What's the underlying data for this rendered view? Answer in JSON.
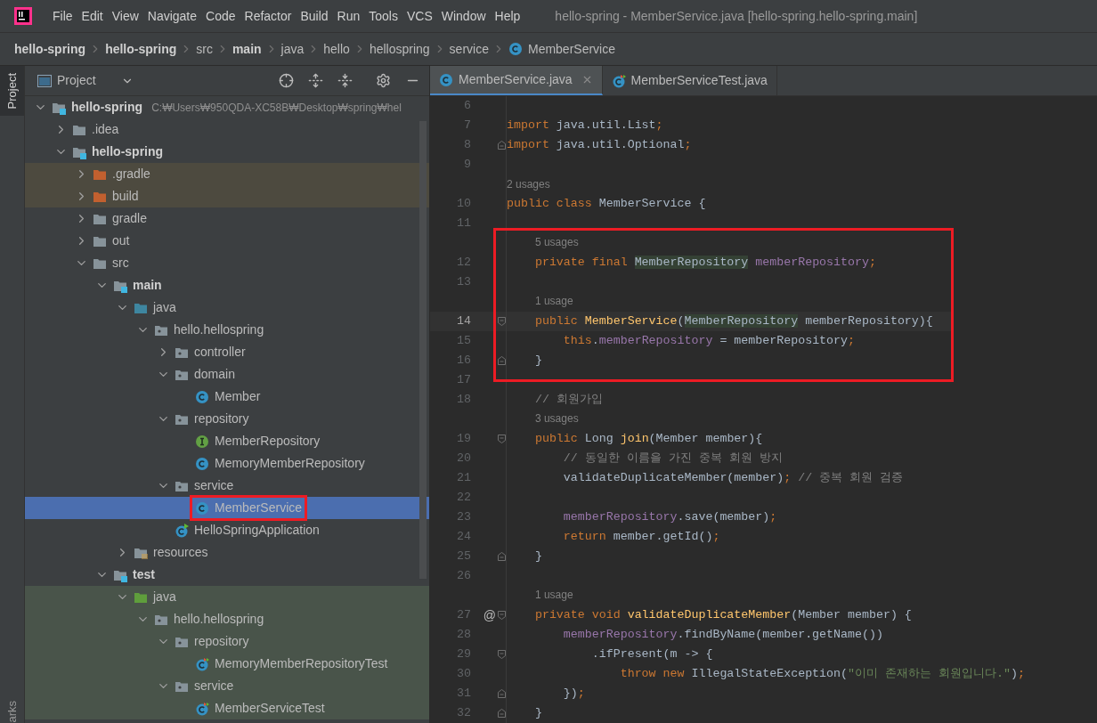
{
  "window": {
    "title": "hello-spring - MemberService.java [hello-spring.hello-spring.main]"
  },
  "menu": [
    "File",
    "Edit",
    "View",
    "Navigate",
    "Code",
    "Refactor",
    "Build",
    "Run",
    "Tools",
    "VCS",
    "Window",
    "Help"
  ],
  "breadcrumbs": [
    {
      "label": "hello-spring",
      "bold": true,
      "kind": "text"
    },
    {
      "label": "hello-spring",
      "bold": true,
      "kind": "text"
    },
    {
      "label": "src",
      "bold": false,
      "kind": "text"
    },
    {
      "label": "main",
      "bold": true,
      "kind": "text"
    },
    {
      "label": "java",
      "bold": false,
      "kind": "text"
    },
    {
      "label": "hello",
      "bold": false,
      "kind": "text"
    },
    {
      "label": "hellospring",
      "bold": false,
      "kind": "text"
    },
    {
      "label": "service",
      "bold": false,
      "kind": "text"
    },
    {
      "label": "MemberService",
      "bold": false,
      "kind": "class"
    }
  ],
  "side_tabs": {
    "top": "Project",
    "bottom": "arks"
  },
  "project_panel": {
    "view": "Project"
  },
  "tree": {
    "children": [
      {
        "label": "hello-spring",
        "kind": "module",
        "bold": true,
        "expanded": true,
        "selected": false,
        "hint": "C:₩Users₩950QDA-XC58B₩Desktop₩spring₩hel",
        "children": [
          {
            "label": ".idea",
            "kind": "folder",
            "bold": false,
            "expanded": false,
            "selected": false
          },
          {
            "label": "hello-spring",
            "kind": "module",
            "bold": true,
            "expanded": true,
            "selected": false,
            "children": [
              {
                "label": ".gradle",
                "kind": "excluded",
                "bold": false,
                "expanded": false,
                "selected": false
              },
              {
                "label": "build",
                "kind": "excluded",
                "bold": false,
                "expanded": false,
                "selected": false
              },
              {
                "label": "gradle",
                "kind": "folder",
                "bold": false,
                "expanded": false,
                "selected": false
              },
              {
                "label": "out",
                "kind": "folder",
                "bold": false,
                "expanded": false,
                "selected": false
              },
              {
                "label": "src",
                "kind": "folder",
                "bold": false,
                "expanded": true,
                "selected": false,
                "children": [
                  {
                    "label": "main",
                    "kind": "module",
                    "bold": true,
                    "expanded": true,
                    "selected": false,
                    "children": [
                      {
                        "label": "java",
                        "kind": "source",
                        "bold": false,
                        "expanded": true,
                        "selected": false,
                        "children": [
                          {
                            "label": "hello.hellospring",
                            "kind": "package",
                            "bold": false,
                            "expanded": true,
                            "selected": false,
                            "children": [
                              {
                                "label": "controller",
                                "kind": "package",
                                "bold": false,
                                "expanded": false,
                                "selected": false
                              },
                              {
                                "label": "domain",
                                "kind": "package",
                                "bold": false,
                                "expanded": true,
                                "selected": false,
                                "children": [
                                  {
                                    "label": "Member",
                                    "kind": "class",
                                    "bold": false,
                                    "selected": false
                                  }
                                ]
                              },
                              {
                                "label": "repository",
                                "kind": "package",
                                "bold": false,
                                "expanded": true,
                                "selected": false,
                                "children": [
                                  {
                                    "label": "MemberRepository",
                                    "kind": "interface",
                                    "bold": false,
                                    "selected": false
                                  },
                                  {
                                    "label": "MemoryMemberRepository",
                                    "kind": "class",
                                    "bold": false,
                                    "selected": false
                                  }
                                ]
                              },
                              {
                                "label": "service",
                                "kind": "package",
                                "bold": false,
                                "expanded": true,
                                "selected": false,
                                "children": [
                                  {
                                    "label": "MemberService",
                                    "kind": "class",
                                    "bold": false,
                                    "selected": true,
                                    "annotated": true
                                  }
                                ]
                              },
                              {
                                "label": "HelloSpringApplication",
                                "kind": "app",
                                "bold": false,
                                "selected": false
                              }
                            ]
                          }
                        ]
                      },
                      {
                        "label": "resources",
                        "kind": "resources",
                        "bold": false,
                        "expanded": false,
                        "selected": false
                      }
                    ]
                  },
                  {
                    "label": "test",
                    "kind": "module",
                    "bold": true,
                    "expanded": true,
                    "selected": false,
                    "children": [
                      {
                        "label": "java",
                        "kind": "test-source",
                        "bold": false,
                        "expanded": true,
                        "selected": false,
                        "children": [
                          {
                            "label": "hello.hellospring",
                            "kind": "package",
                            "bold": false,
                            "expanded": true,
                            "selected": false,
                            "children": [
                              {
                                "label": "repository",
                                "kind": "package",
                                "bold": false,
                                "expanded": true,
                                "selected": false,
                                "children": [
                                  {
                                    "label": "MemoryMemberRepositoryTest",
                                    "kind": "test-class",
                                    "bold": false,
                                    "selected": false
                                  }
                                ]
                              },
                              {
                                "label": "service",
                                "kind": "package",
                                "bold": false,
                                "expanded": true,
                                "selected": false,
                                "children": [
                                  {
                                    "label": "MemberServiceTest",
                                    "kind": "test-class",
                                    "bold": false,
                                    "selected": false
                                  }
                                ]
                              }
                            ]
                          }
                        ]
                      }
                    ]
                  }
                ]
              }
            ]
          }
        ]
      }
    ]
  },
  "editor_tabs": [
    {
      "label": "MemberService.java",
      "kind": "class",
      "selected": true,
      "closable": true
    },
    {
      "label": "MemberServiceTest.java",
      "kind": "test-class",
      "selected": false,
      "closable": false
    }
  ],
  "code": [
    {
      "kind": "line",
      "number": "6"
    },
    {
      "kind": "line",
      "number": "7",
      "tokens": [
        {
          "kind": "kw",
          "text": "import "
        },
        {
          "kind": "plain",
          "text": "java.util.List"
        },
        {
          "kind": "kw",
          "text": ";"
        }
      ]
    },
    {
      "kind": "line",
      "number": "8",
      "fold_close": true,
      "tokens": [
        {
          "kind": "kw",
          "text": "import "
        },
        {
          "kind": "plain",
          "text": "java.util.Optional"
        },
        {
          "kind": "kw",
          "text": ";"
        }
      ]
    },
    {
      "kind": "line",
      "number": "9"
    },
    {
      "kind": "hint",
      "text": "2 usages"
    },
    {
      "kind": "line",
      "number": "10",
      "tokens": [
        {
          "kind": "kw",
          "text": "public class "
        },
        {
          "kind": "plain",
          "text": "MemberService {"
        }
      ]
    },
    {
      "kind": "line",
      "number": "11"
    },
    {
      "kind": "frame",
      "rows": [
        {
          "kind": "hint",
          "text": "    5 usages"
        },
        {
          "kind": "line",
          "number": "12",
          "tokens": [
            {
              "kind": "kw",
              "text": "    private final "
            },
            {
              "kind": "type",
              "text": "MemberRepository"
            },
            {
              "kind": "field",
              "text": " memberRepository"
            },
            {
              "kind": "kw",
              "text": ";"
            }
          ]
        },
        {
          "kind": "line",
          "number": "13"
        },
        {
          "kind": "hint",
          "text": "    1 usage"
        },
        {
          "kind": "line",
          "number": "14",
          "current": true,
          "fold_open": true,
          "tokens": [
            {
              "kind": "kw",
              "text": "    public "
            },
            {
              "kind": "method",
              "text": "MemberService"
            },
            {
              "kind": "plain",
              "text": "("
            },
            {
              "kind": "type",
              "text": "MemberRepository"
            },
            {
              "kind": "plain",
              "text": " memberRepository){"
            }
          ]
        },
        {
          "kind": "line",
          "number": "15",
          "tokens": [
            {
              "kind": "kw",
              "text": "        this"
            },
            {
              "kind": "plain",
              "text": "."
            },
            {
              "kind": "field",
              "text": "memberRepository"
            },
            {
              "kind": "plain",
              "text": " = memberRepository"
            },
            {
              "kind": "kw",
              "text": ";"
            }
          ]
        },
        {
          "kind": "line",
          "number": "16",
          "fold_close": true,
          "tokens": [
            {
              "kind": "plain",
              "text": "    }"
            }
          ]
        }
      ]
    },
    {
      "kind": "line",
      "number": "17"
    },
    {
      "kind": "line",
      "number": "18",
      "tokens": [
        {
          "kind": "comment",
          "text": "    // 회원가입"
        }
      ]
    },
    {
      "kind": "hint",
      "text": "    3 usages"
    },
    {
      "kind": "line",
      "number": "19",
      "fold_open": true,
      "tokens": [
        {
          "kind": "kw",
          "text": "    public "
        },
        {
          "kind": "plain",
          "text": "Long "
        },
        {
          "kind": "method",
          "text": "join"
        },
        {
          "kind": "plain",
          "text": "(Member member){"
        }
      ]
    },
    {
      "kind": "line",
      "number": "20",
      "tokens": [
        {
          "kind": "comment",
          "text": "        // 동일한 이름을 가진 중복 회원 방지"
        }
      ]
    },
    {
      "kind": "line",
      "number": "21",
      "tokens": [
        {
          "kind": "plain",
          "text": "        validateDuplicateMember(member)"
        },
        {
          "kind": "kw",
          "text": ";"
        },
        {
          "kind": "comment",
          "text": " // 중복 회원 검증"
        }
      ]
    },
    {
      "kind": "line",
      "number": "22"
    },
    {
      "kind": "line",
      "number": "23",
      "tokens": [
        {
          "kind": "field",
          "text": "        memberRepository"
        },
        {
          "kind": "plain",
          "text": ".save(member)"
        },
        {
          "kind": "kw",
          "text": ";"
        }
      ]
    },
    {
      "kind": "line",
      "number": "24",
      "tokens": [
        {
          "kind": "kw",
          "text": "        return "
        },
        {
          "kind": "plain",
          "text": "member.getId()"
        },
        {
          "kind": "kw",
          "text": ";"
        }
      ]
    },
    {
      "kind": "line",
      "number": "25",
      "fold_close": true,
      "tokens": [
        {
          "kind": "plain",
          "text": "    }"
        }
      ]
    },
    {
      "kind": "line",
      "number": "26"
    },
    {
      "kind": "hint",
      "text": "    1 usage"
    },
    {
      "kind": "line",
      "number": "27",
      "gutter": "@",
      "fold_open": true,
      "tokens": [
        {
          "kind": "kw",
          "text": "    private void "
        },
        {
          "kind": "method",
          "text": "validateDuplicateMember"
        },
        {
          "kind": "plain",
          "text": "(Member member) {"
        }
      ]
    },
    {
      "kind": "line",
      "number": "28",
      "tokens": [
        {
          "kind": "field",
          "text": "        memberRepository"
        },
        {
          "kind": "plain",
          "text": ".findByName(member.getName())"
        }
      ]
    },
    {
      "kind": "line",
      "number": "29",
      "fold_open": true,
      "tokens": [
        {
          "kind": "plain",
          "text": "            .ifPresent(m -> {"
        }
      ]
    },
    {
      "kind": "line",
      "number": "30",
      "tokens": [
        {
          "kind": "kw",
          "text": "                throw new "
        },
        {
          "kind": "plain",
          "text": "IllegalStateException("
        },
        {
          "kind": "string",
          "text": "\"이미 존재하는 회원입니다.\""
        },
        {
          "kind": "plain",
          "text": ")"
        },
        {
          "kind": "kw",
          "text": ";"
        }
      ]
    },
    {
      "kind": "line",
      "number": "31",
      "fold_close": true,
      "tokens": [
        {
          "kind": "plain",
          "text": "        })"
        },
        {
          "kind": "kw",
          "text": ";"
        }
      ]
    },
    {
      "kind": "line",
      "number": "32",
      "fold_close": true,
      "tokens": [
        {
          "kind": "plain",
          "text": "    }"
        }
      ]
    }
  ]
}
